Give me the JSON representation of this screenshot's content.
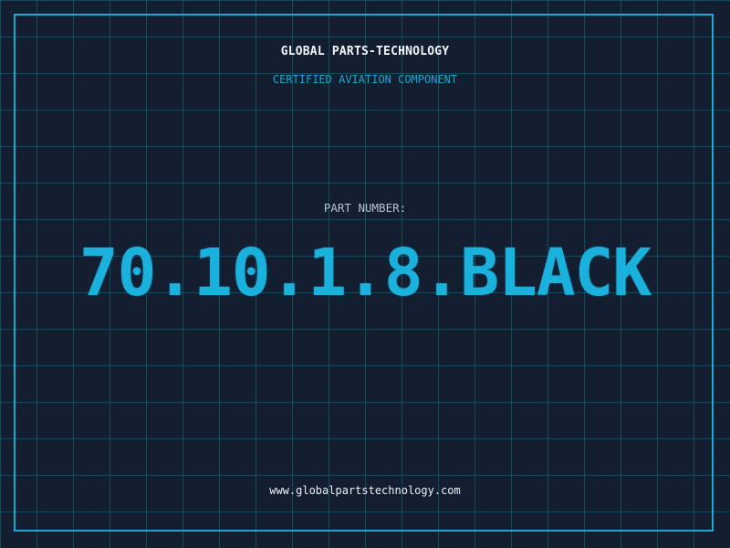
{
  "brand": {
    "company": "GLOBAL PARTS-TECHNOLOGY",
    "tagline": "CERTIFIED AVIATION COMPONENT"
  },
  "part": {
    "label": "PART NUMBER:",
    "number": "70.10.1.8.BLACK"
  },
  "footer": {
    "website": "www.globalpartstechnology.com"
  },
  "colors": {
    "background": "#131e31",
    "grid": "#146e7d",
    "accent": "#1ab2dd",
    "frame": "#19a9d2",
    "text": "#f1f5f8",
    "muted_text": "#b8c2cf"
  }
}
